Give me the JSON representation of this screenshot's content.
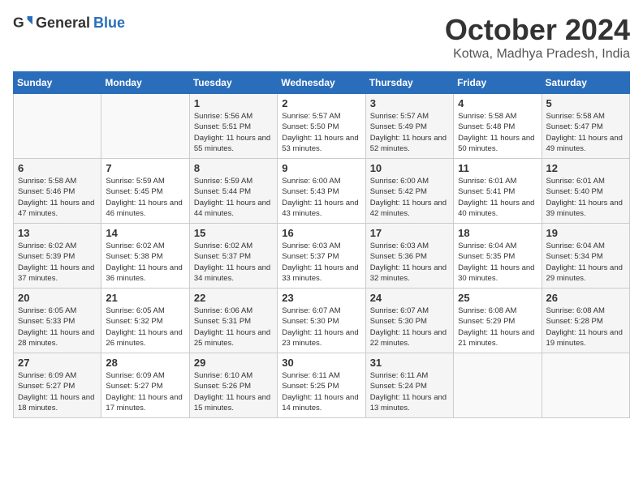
{
  "header": {
    "logo_general": "General",
    "logo_blue": "Blue",
    "month": "October 2024",
    "location": "Kotwa, Madhya Pradesh, India"
  },
  "days_of_week": [
    "Sunday",
    "Monday",
    "Tuesday",
    "Wednesday",
    "Thursday",
    "Friday",
    "Saturday"
  ],
  "weeks": [
    [
      {
        "day": "",
        "sunrise": "",
        "sunset": "",
        "daylight": ""
      },
      {
        "day": "",
        "sunrise": "",
        "sunset": "",
        "daylight": ""
      },
      {
        "day": "1",
        "sunrise": "Sunrise: 5:56 AM",
        "sunset": "Sunset: 5:51 PM",
        "daylight": "Daylight: 11 hours and 55 minutes."
      },
      {
        "day": "2",
        "sunrise": "Sunrise: 5:57 AM",
        "sunset": "Sunset: 5:50 PM",
        "daylight": "Daylight: 11 hours and 53 minutes."
      },
      {
        "day": "3",
        "sunrise": "Sunrise: 5:57 AM",
        "sunset": "Sunset: 5:49 PM",
        "daylight": "Daylight: 11 hours and 52 minutes."
      },
      {
        "day": "4",
        "sunrise": "Sunrise: 5:58 AM",
        "sunset": "Sunset: 5:48 PM",
        "daylight": "Daylight: 11 hours and 50 minutes."
      },
      {
        "day": "5",
        "sunrise": "Sunrise: 5:58 AM",
        "sunset": "Sunset: 5:47 PM",
        "daylight": "Daylight: 11 hours and 49 minutes."
      }
    ],
    [
      {
        "day": "6",
        "sunrise": "Sunrise: 5:58 AM",
        "sunset": "Sunset: 5:46 PM",
        "daylight": "Daylight: 11 hours and 47 minutes."
      },
      {
        "day": "7",
        "sunrise": "Sunrise: 5:59 AM",
        "sunset": "Sunset: 5:45 PM",
        "daylight": "Daylight: 11 hours and 46 minutes."
      },
      {
        "day": "8",
        "sunrise": "Sunrise: 5:59 AM",
        "sunset": "Sunset: 5:44 PM",
        "daylight": "Daylight: 11 hours and 44 minutes."
      },
      {
        "day": "9",
        "sunrise": "Sunrise: 6:00 AM",
        "sunset": "Sunset: 5:43 PM",
        "daylight": "Daylight: 11 hours and 43 minutes."
      },
      {
        "day": "10",
        "sunrise": "Sunrise: 6:00 AM",
        "sunset": "Sunset: 5:42 PM",
        "daylight": "Daylight: 11 hours and 42 minutes."
      },
      {
        "day": "11",
        "sunrise": "Sunrise: 6:01 AM",
        "sunset": "Sunset: 5:41 PM",
        "daylight": "Daylight: 11 hours and 40 minutes."
      },
      {
        "day": "12",
        "sunrise": "Sunrise: 6:01 AM",
        "sunset": "Sunset: 5:40 PM",
        "daylight": "Daylight: 11 hours and 39 minutes."
      }
    ],
    [
      {
        "day": "13",
        "sunrise": "Sunrise: 6:02 AM",
        "sunset": "Sunset: 5:39 PM",
        "daylight": "Daylight: 11 hours and 37 minutes."
      },
      {
        "day": "14",
        "sunrise": "Sunrise: 6:02 AM",
        "sunset": "Sunset: 5:38 PM",
        "daylight": "Daylight: 11 hours and 36 minutes."
      },
      {
        "day": "15",
        "sunrise": "Sunrise: 6:02 AM",
        "sunset": "Sunset: 5:37 PM",
        "daylight": "Daylight: 11 hours and 34 minutes."
      },
      {
        "day": "16",
        "sunrise": "Sunrise: 6:03 AM",
        "sunset": "Sunset: 5:37 PM",
        "daylight": "Daylight: 11 hours and 33 minutes."
      },
      {
        "day": "17",
        "sunrise": "Sunrise: 6:03 AM",
        "sunset": "Sunset: 5:36 PM",
        "daylight": "Daylight: 11 hours and 32 minutes."
      },
      {
        "day": "18",
        "sunrise": "Sunrise: 6:04 AM",
        "sunset": "Sunset: 5:35 PM",
        "daylight": "Daylight: 11 hours and 30 minutes."
      },
      {
        "day": "19",
        "sunrise": "Sunrise: 6:04 AM",
        "sunset": "Sunset: 5:34 PM",
        "daylight": "Daylight: 11 hours and 29 minutes."
      }
    ],
    [
      {
        "day": "20",
        "sunrise": "Sunrise: 6:05 AM",
        "sunset": "Sunset: 5:33 PM",
        "daylight": "Daylight: 11 hours and 28 minutes."
      },
      {
        "day": "21",
        "sunrise": "Sunrise: 6:05 AM",
        "sunset": "Sunset: 5:32 PM",
        "daylight": "Daylight: 11 hours and 26 minutes."
      },
      {
        "day": "22",
        "sunrise": "Sunrise: 6:06 AM",
        "sunset": "Sunset: 5:31 PM",
        "daylight": "Daylight: 11 hours and 25 minutes."
      },
      {
        "day": "23",
        "sunrise": "Sunrise: 6:07 AM",
        "sunset": "Sunset: 5:30 PM",
        "daylight": "Daylight: 11 hours and 23 minutes."
      },
      {
        "day": "24",
        "sunrise": "Sunrise: 6:07 AM",
        "sunset": "Sunset: 5:30 PM",
        "daylight": "Daylight: 11 hours and 22 minutes."
      },
      {
        "day": "25",
        "sunrise": "Sunrise: 6:08 AM",
        "sunset": "Sunset: 5:29 PM",
        "daylight": "Daylight: 11 hours and 21 minutes."
      },
      {
        "day": "26",
        "sunrise": "Sunrise: 6:08 AM",
        "sunset": "Sunset: 5:28 PM",
        "daylight": "Daylight: 11 hours and 19 minutes."
      }
    ],
    [
      {
        "day": "27",
        "sunrise": "Sunrise: 6:09 AM",
        "sunset": "Sunset: 5:27 PM",
        "daylight": "Daylight: 11 hours and 18 minutes."
      },
      {
        "day": "28",
        "sunrise": "Sunrise: 6:09 AM",
        "sunset": "Sunset: 5:27 PM",
        "daylight": "Daylight: 11 hours and 17 minutes."
      },
      {
        "day": "29",
        "sunrise": "Sunrise: 6:10 AM",
        "sunset": "Sunset: 5:26 PM",
        "daylight": "Daylight: 11 hours and 15 minutes."
      },
      {
        "day": "30",
        "sunrise": "Sunrise: 6:11 AM",
        "sunset": "Sunset: 5:25 PM",
        "daylight": "Daylight: 11 hours and 14 minutes."
      },
      {
        "day": "31",
        "sunrise": "Sunrise: 6:11 AM",
        "sunset": "Sunset: 5:24 PM",
        "daylight": "Daylight: 11 hours and 13 minutes."
      },
      {
        "day": "",
        "sunrise": "",
        "sunset": "",
        "daylight": ""
      },
      {
        "day": "",
        "sunrise": "",
        "sunset": "",
        "daylight": ""
      }
    ]
  ]
}
